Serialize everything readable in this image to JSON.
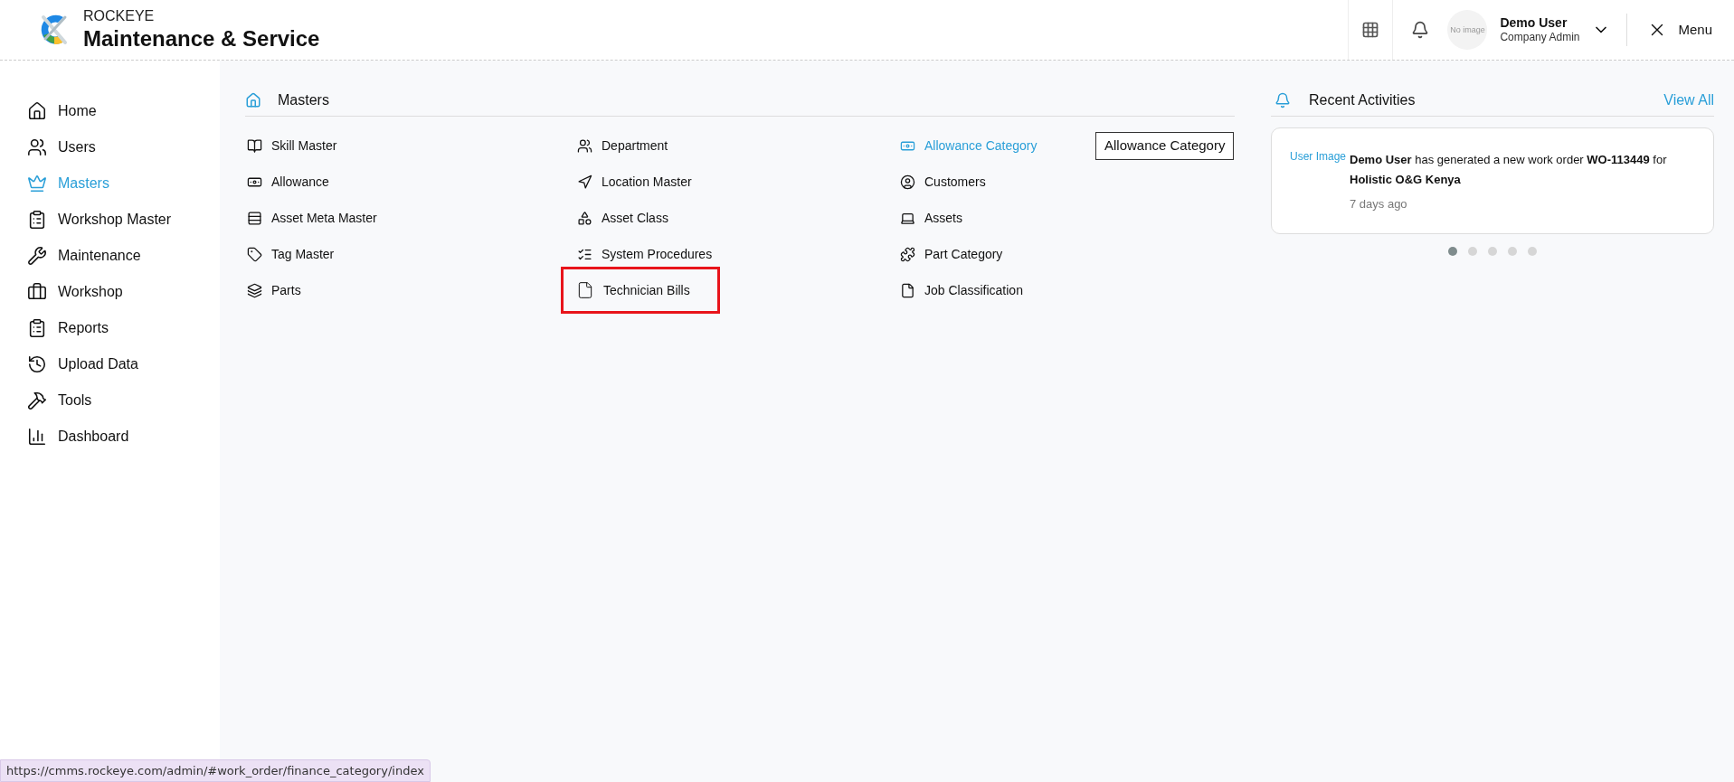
{
  "header": {
    "brand": "ROCKEYE",
    "title": "Maintenance & Service",
    "user": {
      "name": "Demo User",
      "role": "Company Admin",
      "avatar_text": "No image"
    },
    "menu_label": "Menu"
  },
  "sidebar": {
    "items": [
      {
        "label": "Home",
        "selected": false
      },
      {
        "label": "Users",
        "selected": false
      },
      {
        "label": "Masters",
        "selected": true
      },
      {
        "label": "Workshop Master",
        "selected": false
      },
      {
        "label": "Maintenance",
        "selected": false
      },
      {
        "label": "Workshop",
        "selected": false
      },
      {
        "label": "Reports",
        "selected": false
      },
      {
        "label": "Upload Data",
        "selected": false
      },
      {
        "label": "Tools",
        "selected": false
      },
      {
        "label": "Dashboard",
        "selected": false
      }
    ]
  },
  "masters": {
    "title": "Masters",
    "columns": [
      [
        {
          "label": "Skill Master",
          "selected": false,
          "highlighted": false
        },
        {
          "label": "Allowance",
          "selected": false,
          "highlighted": false
        },
        {
          "label": "Asset Meta Master",
          "selected": false,
          "highlighted": false
        },
        {
          "label": "Tag Master",
          "selected": false,
          "highlighted": false
        },
        {
          "label": "Parts",
          "selected": false,
          "highlighted": false
        }
      ],
      [
        {
          "label": "Department",
          "selected": false,
          "highlighted": false
        },
        {
          "label": "Location Master",
          "selected": false,
          "highlighted": false
        },
        {
          "label": "Asset Class",
          "selected": false,
          "highlighted": false
        },
        {
          "label": "System Procedures",
          "selected": false,
          "highlighted": false
        },
        {
          "label": "Technician Bills",
          "selected": false,
          "highlighted": true
        }
      ],
      [
        {
          "label": "Allowance Category",
          "selected": true,
          "highlighted": false,
          "tooltip": "Allowance Category"
        },
        {
          "label": "Customers",
          "selected": false,
          "highlighted": false
        },
        {
          "label": "Assets",
          "selected": false,
          "highlighted": false
        },
        {
          "label": "Part Category",
          "selected": false,
          "highlighted": false
        },
        {
          "label": "Job Classification",
          "selected": false,
          "highlighted": false
        }
      ]
    ]
  },
  "recent_activities": {
    "title": "Recent Activities",
    "view_all": "View All",
    "items": [
      {
        "image_alt": "User Image",
        "text": "**Demo User** has generated a new work order **WO-113449** for **Holistic O&G Kenya**",
        "time": "7 days ago"
      }
    ],
    "dots": [
      {
        "selected": true
      },
      {
        "selected": false
      },
      {
        "selected": false
      },
      {
        "selected": false
      },
      {
        "selected": false
      }
    ]
  },
  "status_bar": {
    "url": "https://cmms.rockeye.com/admin/#work_order/finance_category/index"
  }
}
